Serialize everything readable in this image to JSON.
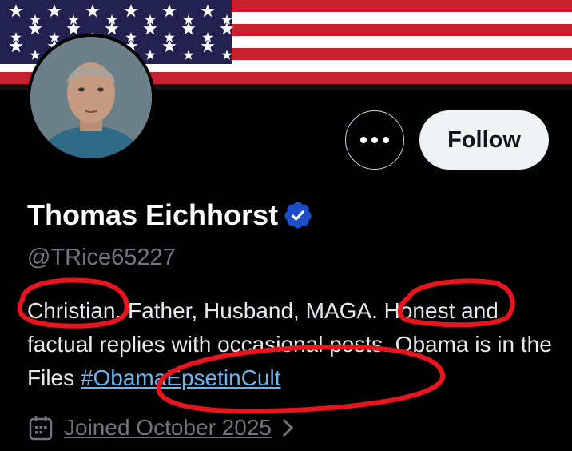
{
  "profile": {
    "display_name": "Thomas Eichhorst",
    "handle": "@TRice65227",
    "verified_icon": "verified-badge-icon",
    "bio_text": "Christian, Father, Husband, MAGA. Honest and factual replies with occasional posts. Obama is in the Files ",
    "bio_hashtag": "#ObamaEpsetinCult",
    "joined": "Joined October 2025"
  },
  "actions": {
    "more_icon": "more-options-icon",
    "follow_label": "Follow"
  },
  "colors": {
    "background": "#000000",
    "follow_bg": "#eff3f4",
    "verified_badge": "#1d4ec9",
    "handle_gray": "#71767b",
    "hashtag_blue": "#6fb6ea",
    "annotation_red": "#e8141e",
    "flag_red": "#b22234",
    "flag_blue": "#3c3b6e"
  }
}
